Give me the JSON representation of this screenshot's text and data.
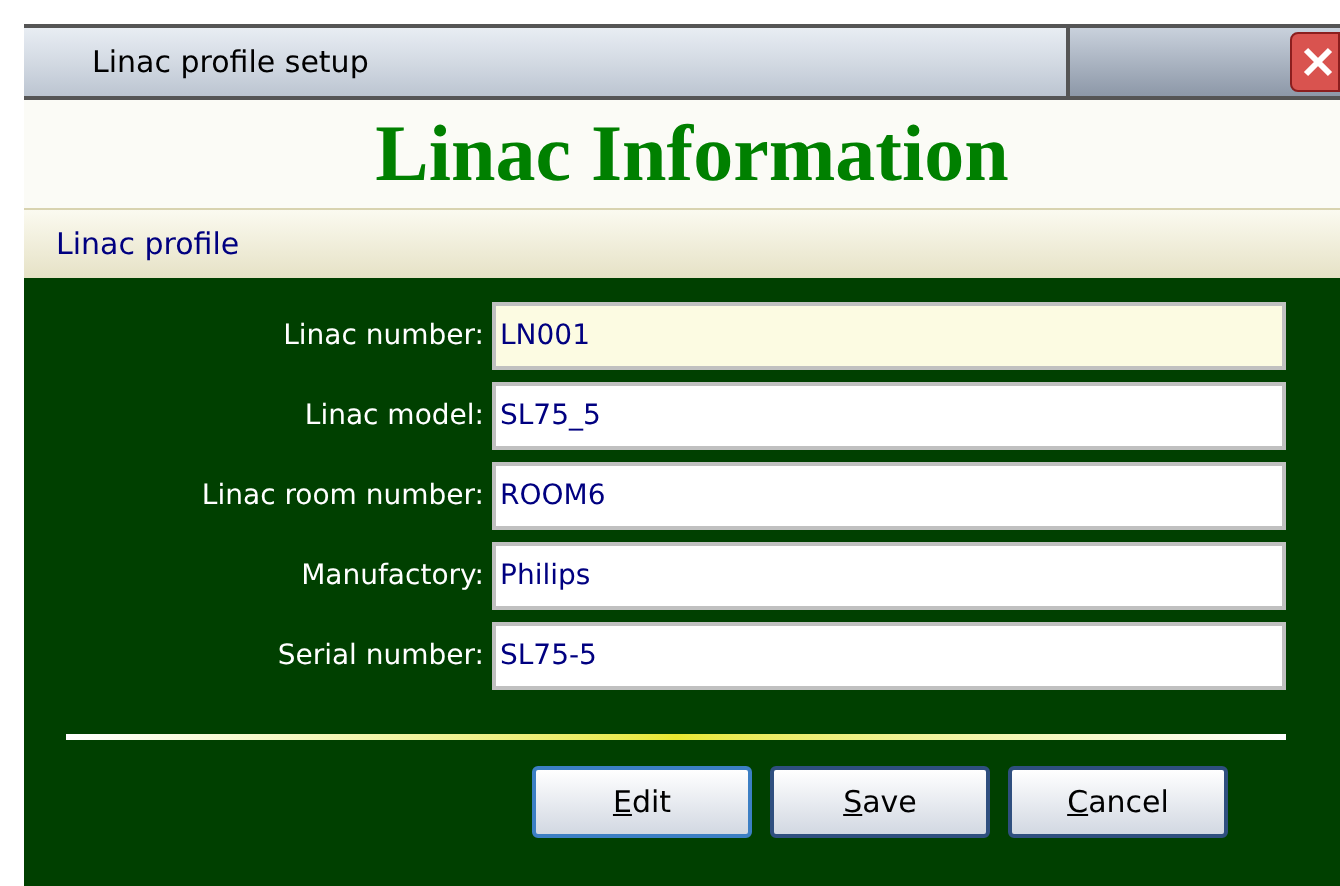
{
  "window": {
    "title": "Linac profile setup"
  },
  "heading": "Linac Information",
  "section": "Linac profile",
  "fields": [
    {
      "label": "Linac number:",
      "value": "LN001",
      "focused": true
    },
    {
      "label": "Linac model:",
      "value": "SL75_5",
      "focused": false
    },
    {
      "label": "Linac room number:",
      "value": "ROOM6",
      "focused": false
    },
    {
      "label": "Manufactory:",
      "value": "Philips",
      "focused": false
    },
    {
      "label": "Serial number:",
      "value": "SL75-5",
      "focused": false
    }
  ],
  "buttons": [
    {
      "label": "Edit",
      "focused": true
    },
    {
      "label": "Save",
      "focused": false
    },
    {
      "label": "Cancel",
      "focused": false
    }
  ]
}
